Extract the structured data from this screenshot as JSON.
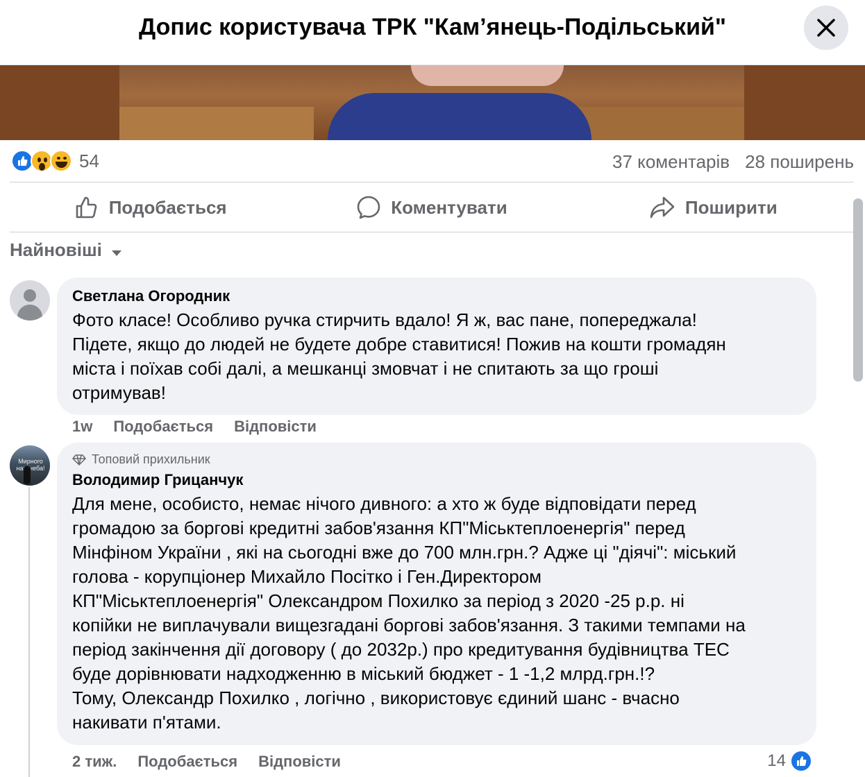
{
  "header": {
    "title": "Допис користувача ТРК \"Кам’янець-Подільський\"",
    "close_icon": "close-icon"
  },
  "post": {
    "reaction_icons": [
      "like-icon",
      "wow-icon",
      "haha-icon"
    ],
    "reaction_count": "54",
    "comments_count": "37 коментарів",
    "shares_count": "28 поширень"
  },
  "actions": {
    "like_label": "Подобається",
    "comment_label": "Коментувати",
    "share_label": "Поширити"
  },
  "sort": {
    "label": "Найновіші"
  },
  "comments": [
    {
      "author": "Светлана Огородник",
      "text": "Фото класе! Особливо ручка стирчить вдало! Я ж, вас пане, попереджала!\nПідете, якщо до людей не будете добре ставитися! Пожив на кошти громадян\nміста і поїхав собі далі, а мешканці змовчат і не спитають за що гроші\nотримував!",
      "time": "1w",
      "like_label": "Подобається",
      "reply_label": "Відповісти"
    },
    {
      "badge": "Топовий прихильник",
      "author": "Володимир Грицанчук",
      "avatar_text": "Мирного нам неба!",
      "text": "Для мене, особисто, немає нічого дивного: а хто ж буде відповідати перед\nгромадою за боргові кредитні забов'язання КП\"Міськтеплоенергія\" перед\nМінфіном України , які на сьогодні вже до 700 млн.грн.? Адже ці \"діячі\": міський\nголова - корупціонер Михайло Посітко і Ген.Директором\nКП\"Міськтеплоенергія\" Олександром Похилко за період з 2020 -25 р.р. ні\nкопійки не виплачували вищезгадані боргові забов'язання. З такими темпами на\nперіод закінчення дії договору ( до 2032р.) про кредитування будівництва ТЕС\nбуде дорівнювати надходженню в міський бюджет - 1 -1,2 млрд.грн.!?\nТому, Олександр Похилко , логічно , використовує єдиний шанс - вчасно\nнакивати п'ятами.",
      "time": "2 тиж.",
      "like_label": "Подобається",
      "reply_label": "Відповісти",
      "likes": "14"
    }
  ]
}
